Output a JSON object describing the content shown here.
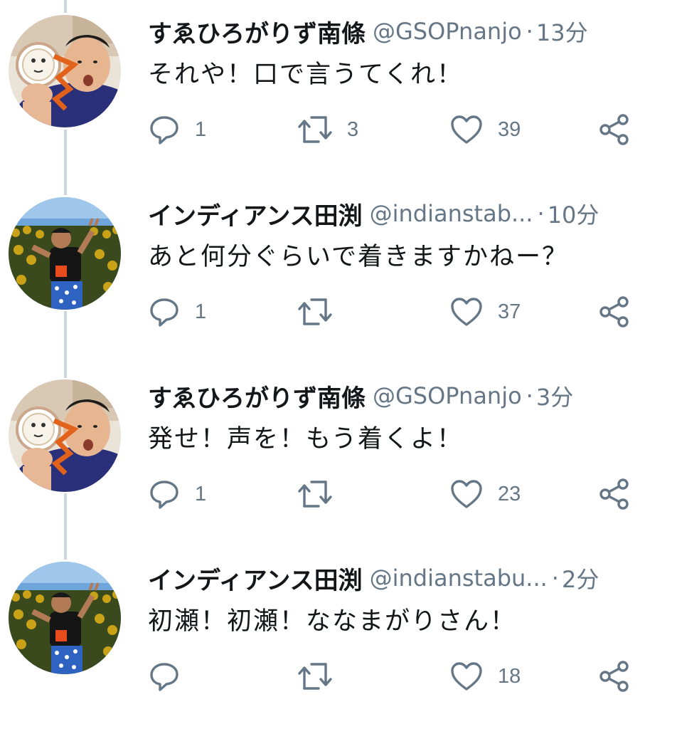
{
  "tweets": [
    {
      "name": "すゑひろがりず南條",
      "handle": "@GSOPnanjo",
      "separator": "·",
      "time": "13分",
      "text": "それや！口で言うてくれ！",
      "replies": "1",
      "retweets": "3",
      "likes": "39",
      "avatar": "nanjo-avatar"
    },
    {
      "name": "インディアンス田渕",
      "handle": "@indianstab...",
      "separator": "·",
      "time": "10分",
      "text": "あと何分ぐらいで着きますかねー？",
      "replies": "1",
      "retweets": "",
      "likes": "37",
      "avatar": "tabuchi-avatar"
    },
    {
      "name": "すゑひろがりず南條",
      "handle": "@GSOPnanjo",
      "separator": "·",
      "time": "3分",
      "text": "発せ！声を！もう着くよ！",
      "replies": "1",
      "retweets": "",
      "likes": "23",
      "avatar": "nanjo-avatar"
    },
    {
      "name": "インディアンス田渕",
      "handle": "@indianstabu...",
      "separator": "·",
      "time": "2分",
      "text": "初瀬！初瀬！ななまがりさん！",
      "replies": "",
      "retweets": "",
      "likes": "18",
      "avatar": "tabuchi-avatar"
    }
  ],
  "icons": {
    "reply": "reply-icon",
    "retweet": "retweet-icon",
    "like": "like-icon",
    "share": "share-icon"
  },
  "colors": {
    "text": "#14171a",
    "secondary": "#657786",
    "thread_line": "#ccd6dd"
  }
}
